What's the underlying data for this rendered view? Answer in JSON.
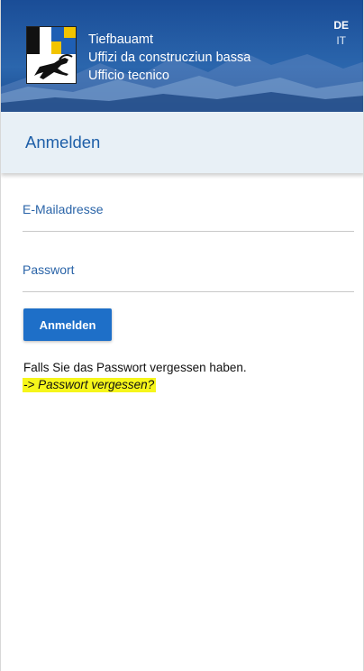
{
  "header": {
    "department_lines": [
      "Tiefbauamt",
      "Uffizi da construcziun bassa",
      "Ufficio tecnico"
    ],
    "languages": [
      {
        "code": "DE",
        "active": true
      },
      {
        "code": "IT",
        "active": false
      }
    ]
  },
  "title_bar": {
    "title": "Anmelden"
  },
  "form": {
    "email_label": "E-Mailadresse",
    "email_value": "",
    "password_label": "Passwort",
    "password_value": "",
    "submit_label": "Anmelden"
  },
  "forgot": {
    "text": "Falls Sie das Passwort vergessen haben.",
    "link_label": "-> Passwort vergessen?"
  },
  "colors": {
    "banner_blue": "#2563ad",
    "title_bar_bg": "#e8f0f6",
    "accent_blue": "#1e5fa8",
    "button_blue": "#1e6fc8",
    "highlight_yellow": "#f6f61a"
  }
}
